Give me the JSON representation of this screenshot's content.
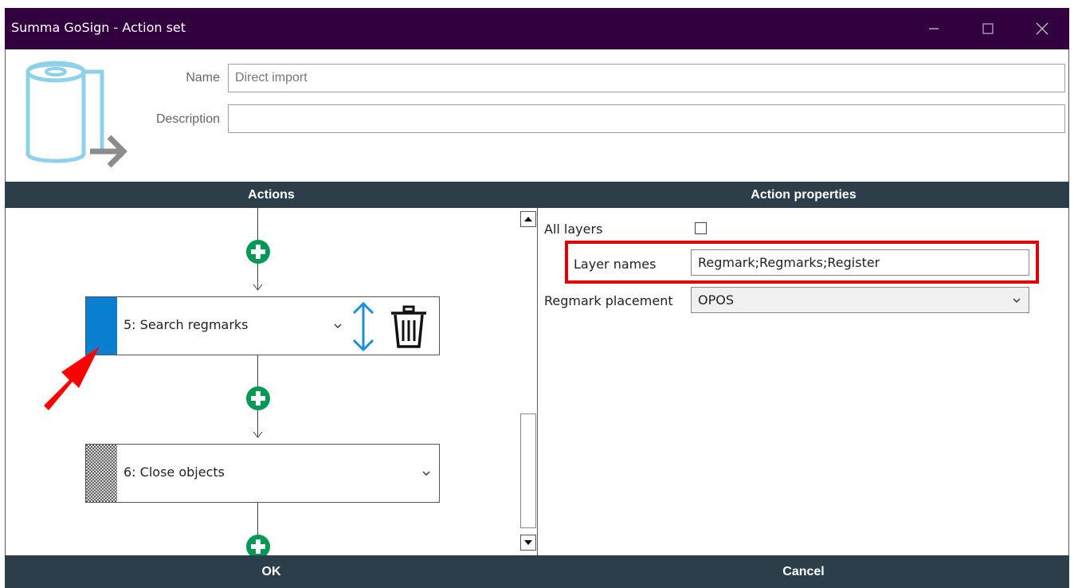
{
  "window": {
    "title": "Summa GoSign - Action set",
    "titlebar_color": "#33003f",
    "minimize_icon": "minimize-icon",
    "maximize_icon": "maximize-icon",
    "close_icon": "close-icon"
  },
  "header": {
    "logo_icon": "roll-media-icon",
    "name_label": "Name",
    "name_value": "Direct import",
    "description_label": "Description",
    "description_value": ""
  },
  "actions": {
    "header": "Actions",
    "items": [
      {
        "label": "5:  Search regmarks",
        "stripe_color": "#0a7fcf",
        "selected": true
      },
      {
        "label": "6:  Close objects",
        "stripe_pattern": "checkered",
        "selected": false
      }
    ],
    "add_icon": "plus-circle-icon",
    "reorder_icon": "up-down-arrow-icon",
    "delete_icon": "trash-icon",
    "add_color": "#009a55"
  },
  "properties": {
    "header": "Action properties",
    "all_layers_label": "All layers",
    "all_layers_checked": false,
    "layer_names_label": "Layer names",
    "layer_names_value": "Regmark;Regmarks;Register",
    "regmark_placement_label": "Regmark placement",
    "regmark_placement_value": "OPOS"
  },
  "footer": {
    "ok_label": "OK",
    "cancel_label": "Cancel"
  },
  "colors": {
    "section_header": "#2d3e4b",
    "highlight": "#e00000",
    "annotation_arrow": "#ff0000"
  }
}
